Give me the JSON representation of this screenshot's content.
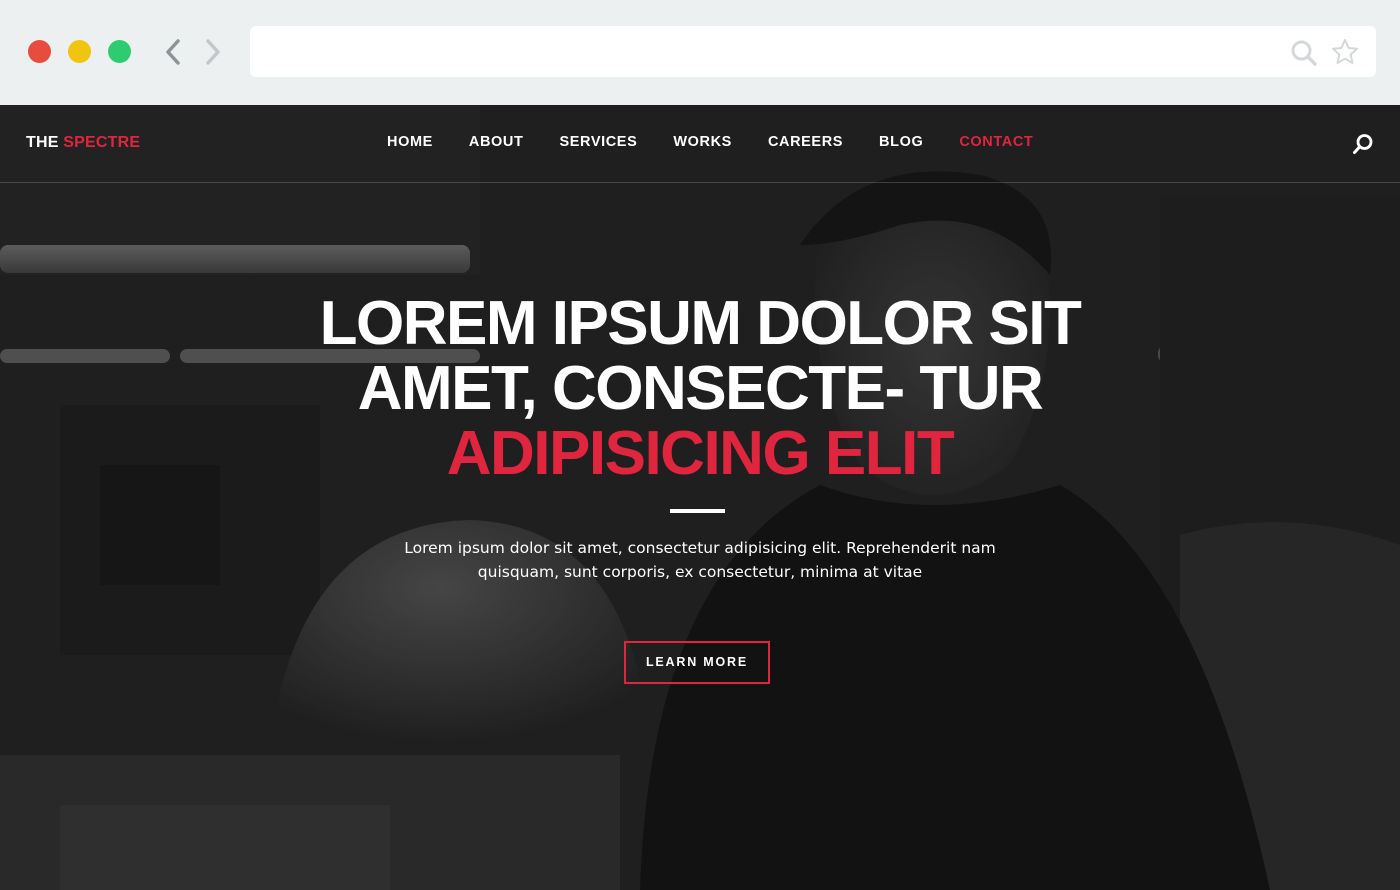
{
  "browser": {
    "url": "",
    "icons": [
      "back-arrow-icon",
      "forward-arrow-icon",
      "search-icon",
      "star-icon"
    ],
    "colors": {
      "close": "#e74c3c",
      "minimize": "#f1c40f",
      "maximize": "#2ecc71"
    }
  },
  "site": {
    "logo": {
      "prefix": "THE",
      "accent": "SPECTRE"
    },
    "nav": [
      {
        "label": "HOME",
        "active": false
      },
      {
        "label": "ABOUT",
        "active": false
      },
      {
        "label": "SERVICES",
        "active": false
      },
      {
        "label": "WORKS",
        "active": false
      },
      {
        "label": "CAREERS",
        "active": false
      },
      {
        "label": "BLOG",
        "active": false
      },
      {
        "label": "CONTACT",
        "active": true
      }
    ],
    "accent_color": "#e0253f"
  },
  "hero": {
    "title_white": "LOREM IPSUM DOLOR SIT AMET, CONSECTE- TUR",
    "title_red": "ADIPISICING ELIT",
    "text": "Lorem ipsum dolor sit amet, consectetur adipisicing elit. Reprehenderit nam quisquam, sunt corporis, ex consectetur, minima at vitae",
    "button": "LEARN MORE"
  }
}
